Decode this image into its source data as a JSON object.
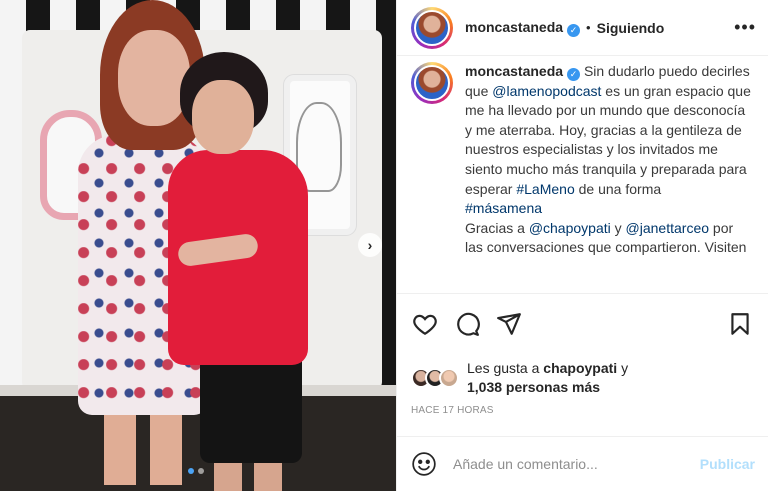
{
  "header": {
    "username": "moncastaneda",
    "separator": "•",
    "follow_status": "Siguiendo",
    "more": "•••"
  },
  "caption": {
    "username": "moncastaneda",
    "part1": "Sin dudarlo puedo decirles que ",
    "mention1": "@lamenopodcast",
    "part2": " es un gran espacio que me ha llevado por un mundo que desconocía y me aterraba. Hoy, gracias a la gentileza de nuestros especialistas y los invitados me siento mucho más tranquila y preparada para esperar ",
    "hashtag1": "#LaMeno",
    "part3": " de una forma ",
    "hashtag2": "#másamena",
    "part4": "Gracias a ",
    "mention2": "@chapoypati",
    "part5": " y ",
    "mention3": "@janettarceo",
    "part6": " por las conversaciones que compartieron. Visiten"
  },
  "likes": {
    "prefix": "Les gusta a ",
    "user": "chapoypati",
    "and": " y",
    "count": "1,038 personas más"
  },
  "timestamp": "HACE 17 HORAS",
  "comment": {
    "placeholder": "Añade un comentario...",
    "publish_label": "Publicar"
  },
  "media": {
    "next_arrow": "›",
    "carousel_total": 2,
    "carousel_current": 1
  },
  "colors": {
    "link": "#00376b",
    "verified": "#3897f0",
    "publish_disabled": "#b2dffc",
    "active_dot": "#4ba3f5"
  },
  "icons": [
    "heart-icon",
    "comment-icon",
    "share-icon",
    "bookmark-icon",
    "emoji-icon",
    "verified-icon",
    "chevron-right-icon"
  ]
}
